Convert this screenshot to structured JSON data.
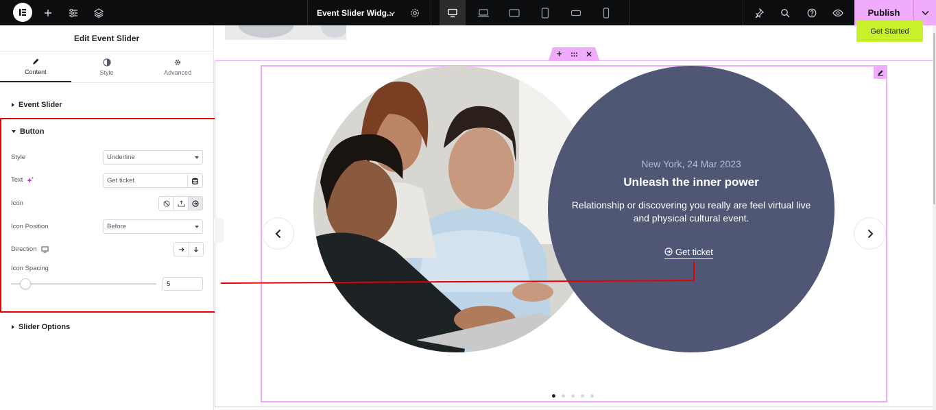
{
  "topbar": {
    "document_title": "Event Slider Widg...",
    "publish_label": "Publish"
  },
  "panel": {
    "title": "Edit Event Slider",
    "tabs": [
      {
        "label": "Content",
        "icon": "pencil-icon"
      },
      {
        "label": "Style",
        "icon": "half-circle-icon"
      },
      {
        "label": "Advanced",
        "icon": "gear-icon"
      }
    ],
    "sections": {
      "event_slider": "Event Slider",
      "button": "Button",
      "slider_options": "Slider Options"
    },
    "controls": {
      "style_label": "Style",
      "style_value": "Underline",
      "text_label": "Text",
      "text_value": "Get ticket",
      "icon_label": "Icon",
      "icon_position_label": "Icon Position",
      "icon_position_value": "Before",
      "direction_label": "Direction",
      "icon_spacing_label": "Icon Spacing",
      "icon_spacing_value": "5",
      "icon_spacing_slider_fraction": 0.1
    }
  },
  "canvas": {
    "get_started_label": "Get Started",
    "event": {
      "meta": "New York, 24 Mar 2023",
      "title": "Unleash the inner power",
      "description": "Relationship or discovering you really are feel virtual live and physical cultural event.",
      "button_label": "Get ticket"
    },
    "slider_dots": 5,
    "active_dot": 0
  },
  "colors": {
    "accent_pink": "#f0abfc",
    "event_circle": "#4f5775",
    "get_started_bg": "#c6f12b",
    "highlight_red": "#e60000"
  }
}
